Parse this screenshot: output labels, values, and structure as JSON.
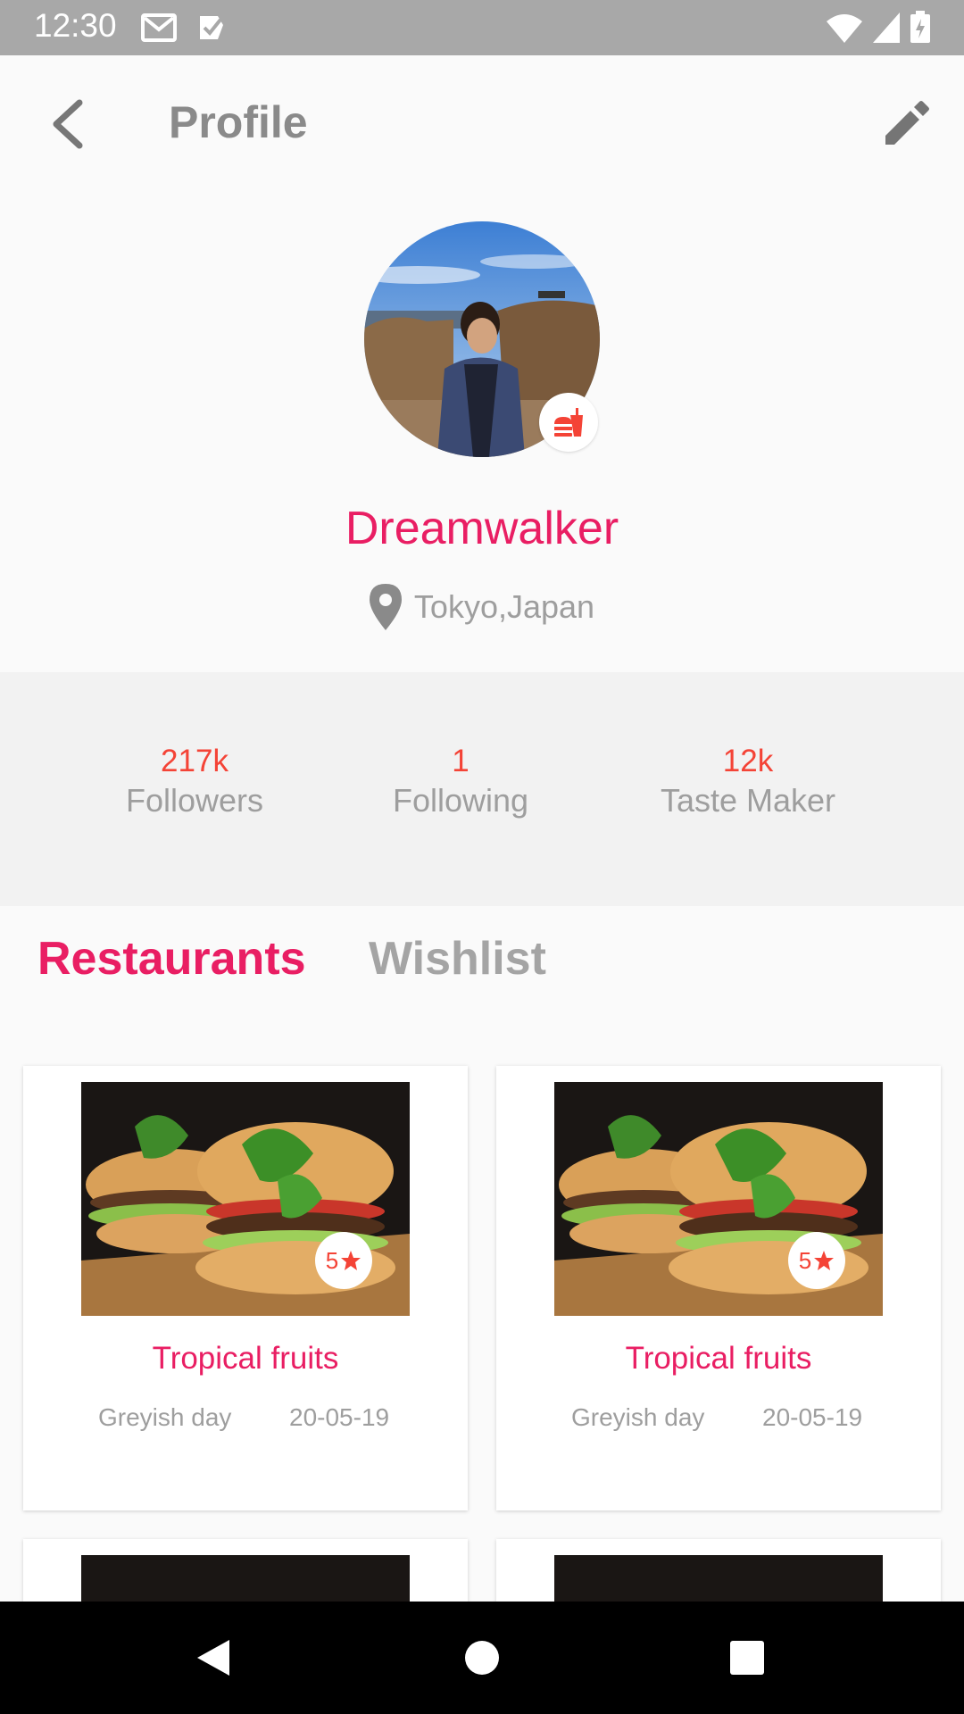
{
  "status_bar": {
    "time": "12:30"
  },
  "app_bar": {
    "title": "Profile"
  },
  "profile": {
    "name": "Dreamwalker",
    "location": "Tokyo,Japan"
  },
  "stats": [
    {
      "value": "217k",
      "label": "Followers"
    },
    {
      "value": "1",
      "label": "Following"
    },
    {
      "value": "12k",
      "label": "Taste Maker"
    }
  ],
  "tabs": [
    {
      "label": "Restaurants",
      "active": true
    },
    {
      "label": "Wishlist",
      "active": false
    }
  ],
  "cards": [
    {
      "title": "Tropical fruits",
      "subtitle": "Greyish day",
      "date": "20-05-19",
      "rating": "5"
    },
    {
      "title": "Tropical fruits",
      "subtitle": "Greyish day",
      "date": "20-05-19",
      "rating": "5"
    }
  ],
  "colors": {
    "accent": "#e91e63",
    "stat": "#f44336",
    "status_bar": "#a8a8a8",
    "nav_bar": "#000000"
  },
  "icons": {
    "back": "arrow-back-icon",
    "edit": "pencil-icon",
    "location": "location-pin-icon",
    "badge": "fastfood-icon",
    "rating": "star-icon"
  }
}
